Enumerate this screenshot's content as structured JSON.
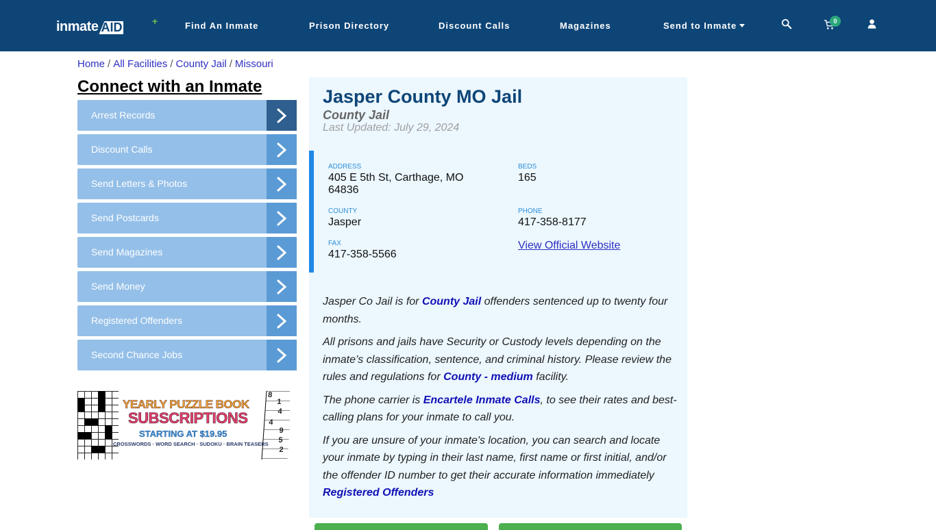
{
  "header": {
    "logo_text": "inmate",
    "logo_accent": "AID",
    "nav": [
      {
        "label": "Find An Inmate"
      },
      {
        "label": "Prison Directory"
      },
      {
        "label": "Discount Calls"
      },
      {
        "label": "Magazines"
      },
      {
        "label": "Send to Inmate",
        "has_dropdown": true
      }
    ],
    "icons": [
      "search-icon",
      "cart-icon",
      "user-icon"
    ],
    "cart_count": "0",
    "colors": {
      "nav_bg": "#0e4577",
      "badge": "#2ba87c"
    }
  },
  "breadcrumb": [
    {
      "label": "Home"
    },
    {
      "label": "All Facilities"
    },
    {
      "label": "County Jail"
    },
    {
      "label": "Missouri"
    }
  ],
  "sidebar": {
    "title": "Connect with an Inmate",
    "items": [
      {
        "label": "Arrest Records",
        "active": true
      },
      {
        "label": "Discount Calls"
      },
      {
        "label": "Send Letters & Photos"
      },
      {
        "label": "Send Postcards"
      },
      {
        "label": "Send Magazines"
      },
      {
        "label": "Send Money"
      },
      {
        "label": "Registered Offenders"
      },
      {
        "label": "Second Chance Jobs"
      }
    ],
    "ad": {
      "line1": "YEARLY PUZZLE BOOK",
      "line2": "SUBSCRIPTIONS",
      "line3": "STARTING AT $19.95",
      "line4": "CROSSWORDS · WORD SEARCH · SUDOKU · BRAIN TEASERS",
      "sudoku_digits": [
        "8",
        "1",
        "4",
        "4",
        "9",
        "5",
        "2"
      ]
    }
  },
  "facility": {
    "name": "Jasper County MO Jail",
    "type": "County Jail",
    "last_updated": "Last Updated: July 29, 2024",
    "fields": {
      "address_label": "ADDRESS",
      "address_line1": "405 E 5th St, Carthage, MO",
      "address_line2": "64836",
      "beds_label": "BEDS",
      "beds": "165",
      "county_label": "COUNTY",
      "county": "Jasper",
      "phone_label": "PHONE",
      "phone": "417-358-8177",
      "fax_label": "FAX",
      "fax": "417-358-5566",
      "website_link": "View Official Website"
    },
    "description": {
      "p1_a": "Jasper Co Jail is for ",
      "p1_link": "County Jail",
      "p1_b": " offenders sentenced up to twenty four months.",
      "p2_a": "All prisons and jails have Security or Custody levels depending on the inmate’s classification, sentence, and criminal history. Please review the rules and regulations for ",
      "p2_link": "County - medium",
      "p2_b": " facility.",
      "p3_a": "The phone carrier is ",
      "p3_link": "Encartele Inmate Calls",
      "p3_b": ", to see their rates and best-calling plans for your inmate to call you.",
      "p4_a": "If you are unsure of your inmate's location, you can search and locate your inmate by typing in their last name, first name or first initial, and/or the offender ID number to get their accurate information immediately",
      "p4_link": "Registered Offenders"
    },
    "colors": {
      "card_bg": "#ecf7fe",
      "accent_bar": "#1e88e5",
      "title": "#0e4577",
      "button": "#4caf50"
    }
  }
}
